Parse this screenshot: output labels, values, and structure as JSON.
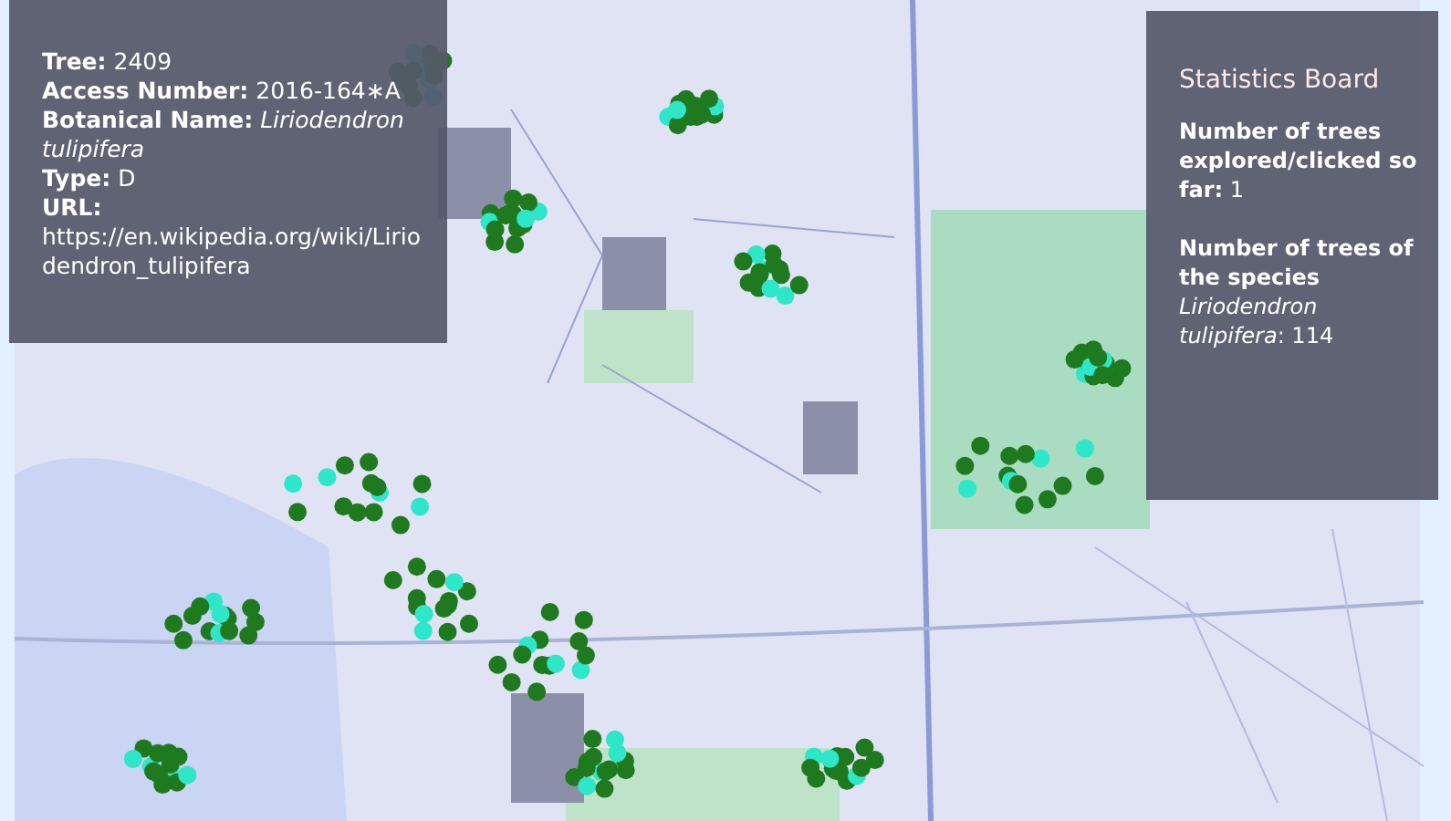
{
  "tree_info": {
    "fields": [
      {
        "label": "Tree:",
        "value": "2409"
      },
      {
        "label": "Access Number:",
        "value": "2016-164∗A"
      },
      {
        "label": "Botanical Name:",
        "value": " *Liriodendron tulipifera*"
      },
      {
        "label": "Type:",
        "value": "D"
      },
      {
        "label": "URL:",
        "value": "https://en.wikipedia.org/wiki/Liriodendron_tulipifera"
      }
    ]
  },
  "statistics_board": {
    "title": "Statistics Board",
    "stats": [
      "**Number of trees explored/clicked so far:** 1",
      "**Number of trees of the species** *Liriodendron tulipifera*: 114"
    ]
  }
}
